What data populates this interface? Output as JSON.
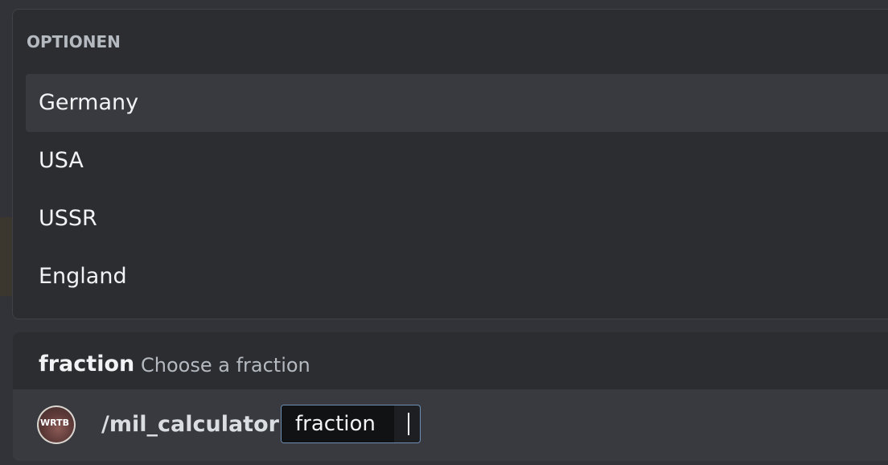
{
  "options": {
    "header": "OPTIONEN",
    "items": [
      {
        "label": "Germany",
        "selected": true
      },
      {
        "label": "USA",
        "selected": false
      },
      {
        "label": "USSR",
        "selected": false
      },
      {
        "label": "England",
        "selected": false
      }
    ]
  },
  "parameter_hint": {
    "name": "fraction",
    "description": "Choose a fraction"
  },
  "composer": {
    "avatar_text": "WRTB",
    "command": "/mil_calculator",
    "param_chip_label": "fraction",
    "param_value": ""
  },
  "colors": {
    "background": "#313338",
    "popup": "#2b2d31",
    "selected_option": "#393a40",
    "chip_border": "#6d8fb5"
  }
}
